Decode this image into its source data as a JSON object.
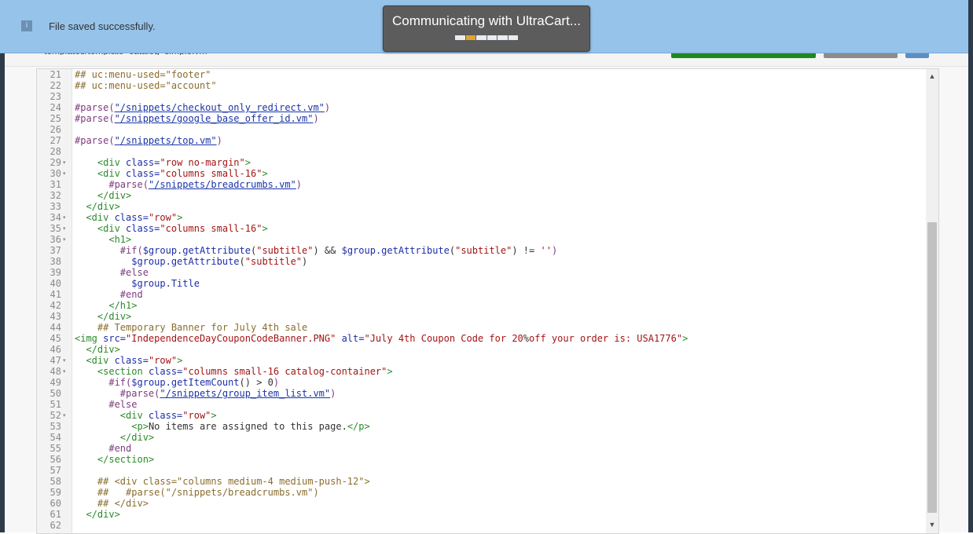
{
  "notification": {
    "icon": "info-icon",
    "message": "File saved successfully."
  },
  "toast": {
    "message": "Communicating with UltraCart...",
    "progress_segments": 6,
    "progress_active_segment": 2
  },
  "dialog": {
    "path_text": "templates/template_catalog_simple.vm"
  },
  "editor": {
    "lines": [
      {
        "n": "21",
        "fold": false,
        "tokens": [
          {
            "c": "comment",
            "t": "## uc:menu-used=\"footer\""
          }
        ]
      },
      {
        "n": "22",
        "fold": false,
        "tokens": [
          {
            "c": "comment",
            "t": "## uc:menu-used=\"account\""
          }
        ]
      },
      {
        "n": "23",
        "fold": false,
        "tokens": []
      },
      {
        "n": "24",
        "fold": false,
        "tokens": [
          {
            "c": "directive",
            "t": "#parse("
          },
          {
            "c": "link",
            "t": "\"/snippets/checkout_only_redirect.vm\""
          },
          {
            "c": "directive",
            "t": ")"
          }
        ]
      },
      {
        "n": "25",
        "fold": false,
        "tokens": [
          {
            "c": "directive",
            "t": "#parse("
          },
          {
            "c": "link",
            "t": "\"/snippets/google_base_offer_id.vm\""
          },
          {
            "c": "directive",
            "t": ")"
          }
        ]
      },
      {
        "n": "26",
        "fold": false,
        "tokens": []
      },
      {
        "n": "27",
        "fold": false,
        "tokens": [
          {
            "c": "directive",
            "t": "#parse("
          },
          {
            "c": "link",
            "t": "\"/snippets/top.vm\""
          },
          {
            "c": "directive",
            "t": ")"
          }
        ]
      },
      {
        "n": "28",
        "fold": false,
        "tokens": []
      },
      {
        "n": "29",
        "fold": true,
        "tokens": [
          {
            "c": "plain",
            "t": "    "
          },
          {
            "c": "tag",
            "t": "<div "
          },
          {
            "c": "attr",
            "t": "class="
          },
          {
            "c": "str",
            "t": "\"row no-margin\""
          },
          {
            "c": "tag",
            "t": ">"
          }
        ]
      },
      {
        "n": "30",
        "fold": true,
        "tokens": [
          {
            "c": "plain",
            "t": "    "
          },
          {
            "c": "tag",
            "t": "<div "
          },
          {
            "c": "attr",
            "t": "class="
          },
          {
            "c": "str",
            "t": "\"columns small-16\""
          },
          {
            "c": "tag",
            "t": ">"
          }
        ]
      },
      {
        "n": "31",
        "fold": false,
        "tokens": [
          {
            "c": "plain",
            "t": "      "
          },
          {
            "c": "directive",
            "t": "#parse("
          },
          {
            "c": "link",
            "t": "\"/snippets/breadcrumbs.vm\""
          },
          {
            "c": "directive",
            "t": ")"
          }
        ]
      },
      {
        "n": "32",
        "fold": false,
        "tokens": [
          {
            "c": "plain",
            "t": "    "
          },
          {
            "c": "tag",
            "t": "</div>"
          }
        ]
      },
      {
        "n": "33",
        "fold": false,
        "tokens": [
          {
            "c": "plain",
            "t": "  "
          },
          {
            "c": "tag",
            "t": "</div>"
          }
        ]
      },
      {
        "n": "34",
        "fold": true,
        "tokens": [
          {
            "c": "plain",
            "t": "  "
          },
          {
            "c": "tag",
            "t": "<div "
          },
          {
            "c": "attr",
            "t": "class="
          },
          {
            "c": "str",
            "t": "\"row\""
          },
          {
            "c": "tag",
            "t": ">"
          }
        ]
      },
      {
        "n": "35",
        "fold": true,
        "tokens": [
          {
            "c": "plain",
            "t": "    "
          },
          {
            "c": "tag",
            "t": "<div "
          },
          {
            "c": "attr",
            "t": "class="
          },
          {
            "c": "str",
            "t": "\"columns small-16\""
          },
          {
            "c": "tag",
            "t": ">"
          }
        ]
      },
      {
        "n": "36",
        "fold": true,
        "tokens": [
          {
            "c": "plain",
            "t": "      "
          },
          {
            "c": "tag",
            "t": "<h1>"
          }
        ]
      },
      {
        "n": "37",
        "fold": false,
        "tokens": [
          {
            "c": "plain",
            "t": "        "
          },
          {
            "c": "directive",
            "t": "#if("
          },
          {
            "c": "var",
            "t": "$group.getAttribute"
          },
          {
            "c": "plain",
            "t": "("
          },
          {
            "c": "str",
            "t": "\"subtitle\""
          },
          {
            "c": "plain",
            "t": ") && "
          },
          {
            "c": "var",
            "t": "$group.getAttribute"
          },
          {
            "c": "plain",
            "t": "("
          },
          {
            "c": "str",
            "t": "\"subtitle\""
          },
          {
            "c": "plain",
            "t": ") != "
          },
          {
            "c": "str",
            "t": "''"
          },
          {
            "c": "directive",
            "t": ")"
          }
        ]
      },
      {
        "n": "38",
        "fold": false,
        "tokens": [
          {
            "c": "plain",
            "t": "          "
          },
          {
            "c": "var",
            "t": "$group.getAttribute"
          },
          {
            "c": "plain",
            "t": "("
          },
          {
            "c": "str",
            "t": "\"subtitle\""
          },
          {
            "c": "plain",
            "t": ")"
          }
        ]
      },
      {
        "n": "39",
        "fold": false,
        "tokens": [
          {
            "c": "plain",
            "t": "        "
          },
          {
            "c": "directive",
            "t": "#else"
          }
        ]
      },
      {
        "n": "40",
        "fold": false,
        "tokens": [
          {
            "c": "plain",
            "t": "          "
          },
          {
            "c": "var",
            "t": "$group.Title"
          }
        ]
      },
      {
        "n": "41",
        "fold": false,
        "tokens": [
          {
            "c": "plain",
            "t": "        "
          },
          {
            "c": "directive",
            "t": "#end"
          }
        ]
      },
      {
        "n": "42",
        "fold": false,
        "tokens": [
          {
            "c": "plain",
            "t": "      "
          },
          {
            "c": "tag",
            "t": "</h1>"
          }
        ]
      },
      {
        "n": "43",
        "fold": false,
        "tokens": [
          {
            "c": "plain",
            "t": "    "
          },
          {
            "c": "tag",
            "t": "</div>"
          }
        ]
      },
      {
        "n": "44",
        "fold": false,
        "tokens": [
          {
            "c": "plain",
            "t": "    "
          },
          {
            "c": "comment",
            "t": "## Temporary Banner for July 4th sale"
          }
        ]
      },
      {
        "n": "45",
        "fold": false,
        "tokens": [
          {
            "c": "tag",
            "t": "<img "
          },
          {
            "c": "attr",
            "t": "src="
          },
          {
            "c": "str",
            "t": "\"IndependenceDayCouponCodeBanner.PNG\""
          },
          {
            "c": "plain",
            "t": " "
          },
          {
            "c": "attr",
            "t": "alt="
          },
          {
            "c": "str",
            "t": "\"July 4th Coupon Code for 20"
          },
          {
            "c": "plain",
            "t": "%"
          },
          {
            "c": "str",
            "t": "off your order is: USA1776\""
          },
          {
            "c": "tag",
            "t": ">"
          }
        ]
      },
      {
        "n": "46",
        "fold": false,
        "tokens": [
          {
            "c": "plain",
            "t": "  "
          },
          {
            "c": "tag",
            "t": "</div>"
          }
        ]
      },
      {
        "n": "47",
        "fold": true,
        "tokens": [
          {
            "c": "plain",
            "t": "  "
          },
          {
            "c": "tag",
            "t": "<div "
          },
          {
            "c": "attr",
            "t": "class="
          },
          {
            "c": "str",
            "t": "\"row\""
          },
          {
            "c": "tag",
            "t": ">"
          }
        ]
      },
      {
        "n": "48",
        "fold": true,
        "tokens": [
          {
            "c": "plain",
            "t": "    "
          },
          {
            "c": "tag",
            "t": "<section "
          },
          {
            "c": "attr",
            "t": "class="
          },
          {
            "c": "str",
            "t": "\"columns small-16 catalog-container\""
          },
          {
            "c": "tag",
            "t": ">"
          }
        ]
      },
      {
        "n": "49",
        "fold": false,
        "tokens": [
          {
            "c": "plain",
            "t": "      "
          },
          {
            "c": "directive",
            "t": "#if("
          },
          {
            "c": "var",
            "t": "$group.getItemCount"
          },
          {
            "c": "plain",
            "t": "() > 0"
          },
          {
            "c": "directive",
            "t": ")"
          }
        ]
      },
      {
        "n": "50",
        "fold": false,
        "tokens": [
          {
            "c": "plain",
            "t": "        "
          },
          {
            "c": "directive",
            "t": "#parse("
          },
          {
            "c": "link",
            "t": "\"/snippets/group_item_list.vm\""
          },
          {
            "c": "directive",
            "t": ")"
          }
        ]
      },
      {
        "n": "51",
        "fold": false,
        "tokens": [
          {
            "c": "plain",
            "t": "      "
          },
          {
            "c": "directive",
            "t": "#else"
          }
        ]
      },
      {
        "n": "52",
        "fold": true,
        "tokens": [
          {
            "c": "plain",
            "t": "        "
          },
          {
            "c": "tag",
            "t": "<div "
          },
          {
            "c": "attr",
            "t": "class="
          },
          {
            "c": "str",
            "t": "\"row\""
          },
          {
            "c": "tag",
            "t": ">"
          }
        ]
      },
      {
        "n": "53",
        "fold": false,
        "tokens": [
          {
            "c": "plain",
            "t": "          "
          },
          {
            "c": "tag",
            "t": "<p>"
          },
          {
            "c": "plain",
            "t": "No items are assigned to this page."
          },
          {
            "c": "tag",
            "t": "</p>"
          }
        ]
      },
      {
        "n": "54",
        "fold": false,
        "tokens": [
          {
            "c": "plain",
            "t": "        "
          },
          {
            "c": "tag",
            "t": "</div>"
          }
        ]
      },
      {
        "n": "55",
        "fold": false,
        "tokens": [
          {
            "c": "plain",
            "t": "      "
          },
          {
            "c": "directive",
            "t": "#end"
          }
        ]
      },
      {
        "n": "56",
        "fold": false,
        "tokens": [
          {
            "c": "plain",
            "t": "    "
          },
          {
            "c": "tag",
            "t": "</section>"
          }
        ]
      },
      {
        "n": "57",
        "fold": false,
        "tokens": []
      },
      {
        "n": "58",
        "fold": false,
        "tokens": [
          {
            "c": "plain",
            "t": "    "
          },
          {
            "c": "comment",
            "t": "## <div class=\"columns medium-4 medium-push-12\">"
          }
        ]
      },
      {
        "n": "59",
        "fold": false,
        "tokens": [
          {
            "c": "plain",
            "t": "    "
          },
          {
            "c": "comment",
            "t": "##   #parse(\"/snippets/breadcrumbs.vm\")"
          }
        ]
      },
      {
        "n": "60",
        "fold": false,
        "tokens": [
          {
            "c": "plain",
            "t": "    "
          },
          {
            "c": "comment",
            "t": "## </div>"
          }
        ]
      },
      {
        "n": "61",
        "fold": false,
        "tokens": [
          {
            "c": "plain",
            "t": "  "
          },
          {
            "c": "tag",
            "t": "</div>"
          }
        ]
      },
      {
        "n": "62",
        "fold": false,
        "tokens": []
      }
    ]
  },
  "scrollbar": {
    "up_icon": "scroll-up-arrow-icon",
    "down_icon": "scroll-down-arrow-icon"
  },
  "colors": {
    "notification_bg": "#96c3ea",
    "toast_bg": "#5c5c5c",
    "toast_progress_active": "#e2a52e",
    "save_button": "#1c8a1c"
  }
}
